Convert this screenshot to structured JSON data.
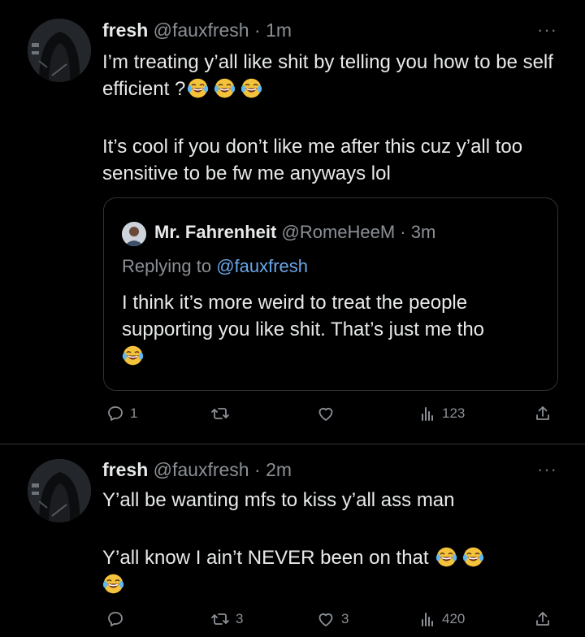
{
  "tweets": [
    {
      "display_name": "fresh",
      "handle": "@fauxfresh",
      "time": "1m",
      "paragraphs": [
        "I’m treating y’all like shit by telling you how to be self efficient ?",
        "It’s cool if you don’t like me after this cuz y’all too sensitive to be fw me anyways lol"
      ],
      "quote": {
        "display_name": "Mr. Fahrenheit",
        "handle": "@RomeHeeM",
        "time": "3m",
        "replying_prefix": "Replying to ",
        "replying_handle": "@fauxfresh",
        "text": "I think it’s more weird to treat the people supporting you like shit. That’s just me tho"
      },
      "actions": {
        "replies": "1",
        "retweets": "",
        "likes": "",
        "views": "123"
      }
    },
    {
      "display_name": "fresh",
      "handle": "@fauxfresh",
      "time": "2m",
      "paragraphs": [
        "Y’all be wanting mfs to kiss y’all ass man",
        "Y’all know I ain’t NEVER been on that"
      ],
      "actions": {
        "replies": "",
        "retweets": "3",
        "likes": "3",
        "views": "420"
      }
    }
  ],
  "separator": " · ",
  "more_glyph": "···",
  "colors": {
    "background": "#000000",
    "text": "#e7e9ea",
    "secondary": "#8b9096",
    "link": "#6aa6e8",
    "border": "#2f3336"
  },
  "icons": [
    "reply-icon",
    "retweet-icon",
    "like-icon",
    "views-icon",
    "share-icon",
    "laughing-crying-emoji"
  ]
}
